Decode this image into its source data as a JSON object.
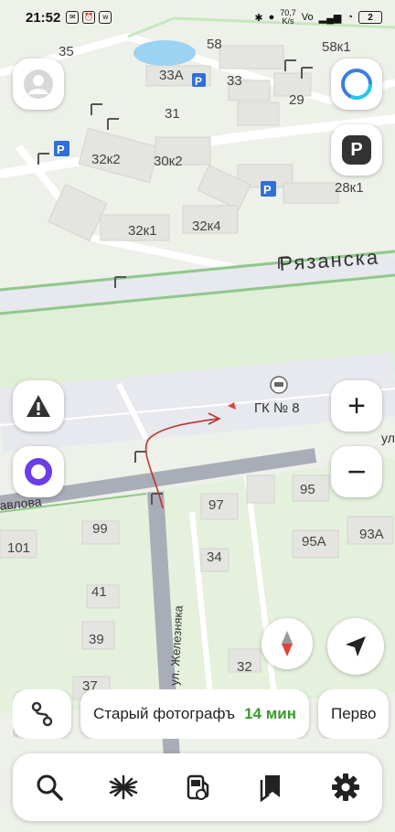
{
  "status_bar": {
    "time": "21:52",
    "network_speed_value": "70,7",
    "network_speed_unit": "K/s",
    "battery": "2"
  },
  "map": {
    "street_main": "Рязанска",
    "street_side": "ул. Железняка",
    "street_left": "авлова",
    "street_right": "ул",
    "poi_label": "ГК № 8",
    "buildings": [
      {
        "label": "35"
      },
      {
        "label": "58"
      },
      {
        "label": "58к1"
      },
      {
        "label": "33А"
      },
      {
        "label": "33"
      },
      {
        "label": "29"
      },
      {
        "label": "31"
      },
      {
        "label": "32к2"
      },
      {
        "label": "30к2"
      },
      {
        "label": "28к1"
      },
      {
        "label": "32к1"
      },
      {
        "label": "32к4"
      },
      {
        "label": "95"
      },
      {
        "label": "97"
      },
      {
        "label": "99"
      },
      {
        "label": "101"
      },
      {
        "label": "95А"
      },
      {
        "label": "93А"
      },
      {
        "label": "34"
      },
      {
        "label": "41"
      },
      {
        "label": "39"
      },
      {
        "label": "37"
      },
      {
        "label": "32"
      }
    ]
  },
  "route_suggestions": [
    {
      "name": "Старый фотографъ",
      "eta": "14 мин"
    },
    {
      "name": "Перво",
      "eta": ""
    }
  ],
  "controls": {
    "parking_label": "P",
    "zoom_in": "+",
    "zoom_out": "−"
  },
  "icons": {
    "profile": "avatar-icon",
    "alice_top": "alice-ring-icon",
    "parking": "parking-icon",
    "alert": "warning-triangle-icon",
    "alice": "alice-icon",
    "compass": "compass-icon",
    "locate": "locate-arrow-icon",
    "route_switch": "route-icon",
    "tabs": [
      "search-icon",
      "explore-icon",
      "fuel-icon",
      "bookmarks-icon",
      "settings-icon"
    ]
  },
  "colors": {
    "map_bg": "#eef1ea",
    "green_area": "#dff0d6",
    "road": "#e7e9ee",
    "main_road_border": "#8fc88a",
    "alley": "#a9adb8",
    "route_line": "#c0342f",
    "eta_green": "#3a9a2c",
    "parking_blue": "#2f6fd8",
    "alice_purple": "#6a3de8"
  }
}
